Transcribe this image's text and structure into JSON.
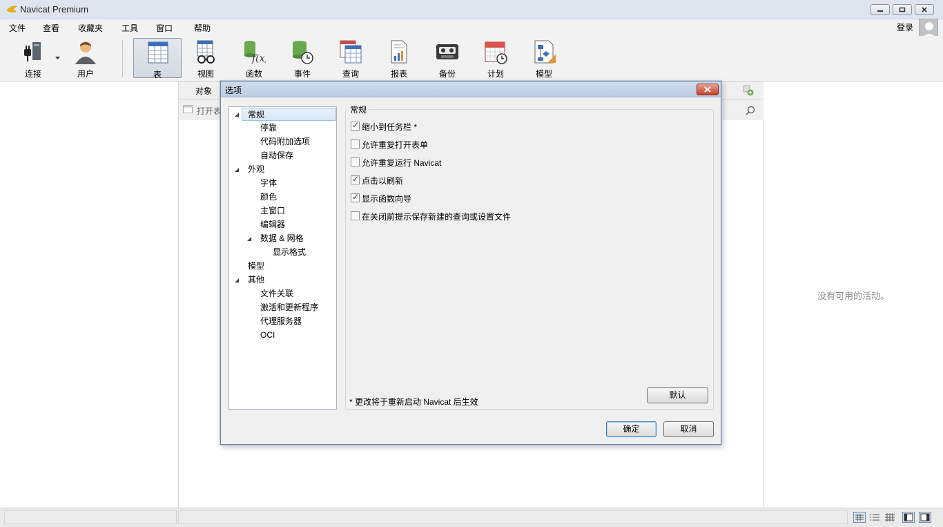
{
  "app": {
    "title": "Navicat Premium"
  },
  "menu": {
    "items": [
      "文件",
      "查看",
      "收藏夹",
      "工具",
      "窗口",
      "帮助"
    ],
    "login": "登录"
  },
  "toolbar": {
    "connect": "连接",
    "user": "用户",
    "table": "表",
    "view": "视图",
    "function": "函数",
    "event": "事件",
    "query": "查询",
    "report": "报表",
    "backup": "备份",
    "schedule": "计划",
    "model": "模型"
  },
  "center": {
    "tab": "对象",
    "open_table": "打开表"
  },
  "right": {
    "empty": "没有可用的活动。"
  },
  "dialog": {
    "title": "选项",
    "tree": [
      "常规",
      "停靠",
      "代码附加选项",
      "自动保存",
      "外观",
      "字体",
      "颜色",
      "主窗口",
      "编辑器",
      "数据 & 网格",
      "显示格式",
      "模型",
      "其他",
      "文件关联",
      "激活和更新程序",
      "代理服务器",
      "OCI"
    ],
    "group_title": "常规",
    "options": [
      {
        "label": "缩小到任务栏 *",
        "checked": true
      },
      {
        "label": "允许重复打开表单",
        "checked": false
      },
      {
        "label": "允许重复运行 Navicat",
        "checked": false
      },
      {
        "label": "点击以刷新",
        "checked": true
      },
      {
        "label": "显示函数向导",
        "checked": true
      },
      {
        "label": "在关闭前提示保存新建的查询或设置文件",
        "checked": false
      }
    ],
    "note": "* 更改将于重新启动 Navicat 后生效",
    "default_btn": "默认",
    "ok_btn": "确定",
    "cancel_btn": "取消"
  },
  "colors": {
    "accent_blue": "#3c7fb1",
    "close_red": "#c8432c"
  }
}
